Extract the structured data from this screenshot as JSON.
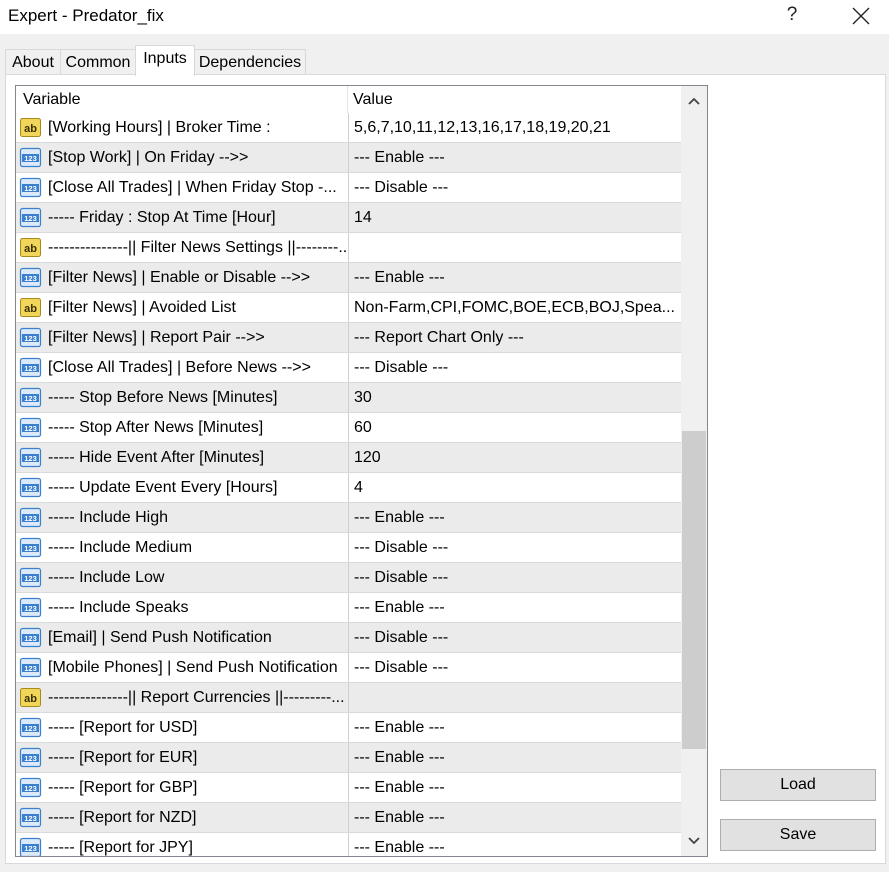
{
  "window": {
    "title": "Expert - Predator_fix",
    "help_label": "?"
  },
  "tabs": [
    {
      "label": "About",
      "active": false
    },
    {
      "label": "Common",
      "active": false
    },
    {
      "label": "Inputs",
      "active": true
    },
    {
      "label": "Dependencies",
      "active": false
    }
  ],
  "grid": {
    "columns": {
      "variable": "Variable",
      "value": "Value"
    },
    "rows": [
      {
        "icon": "ab",
        "variable": "[Working Hours] | Broker Time :",
        "value": "5,6,7,10,11,12,13,16,17,18,19,20,21"
      },
      {
        "icon": "123",
        "variable": "[Stop Work] | On Friday -->>",
        "value": "--- Enable ---"
      },
      {
        "icon": "123",
        "variable": "[Close All Trades] | When Friday Stop -...",
        "value": "--- Disable ---"
      },
      {
        "icon": "123",
        "variable": "----- Friday : Stop At Time [Hour]",
        "value": "14"
      },
      {
        "icon": "ab",
        "variable": "---------------|| Filter News Settings ||--------...",
        "value": ""
      },
      {
        "icon": "123",
        "variable": "[Filter News] | Enable or Disable -->>",
        "value": "--- Enable ---"
      },
      {
        "icon": "ab",
        "variable": "[Filter News] | Avoided List",
        "value": "Non-Farm,CPI,FOMC,BOE,ECB,BOJ,Spea..."
      },
      {
        "icon": "123",
        "variable": "[Filter News] | Report Pair -->>",
        "value": "--- Report Chart Only ---"
      },
      {
        "icon": "123",
        "variable": "[Close All Trades] | Before News -->>",
        "value": "--- Disable ---"
      },
      {
        "icon": "123",
        "variable": "----- Stop Before News [Minutes]",
        "value": "30"
      },
      {
        "icon": "123",
        "variable": "----- Stop After News [Minutes]",
        "value": "60"
      },
      {
        "icon": "123",
        "variable": "----- Hide Event After [Minutes]",
        "value": "120"
      },
      {
        "icon": "123",
        "variable": "----- Update Event Every [Hours]",
        "value": "4"
      },
      {
        "icon": "123",
        "variable": "----- Include High",
        "value": "--- Enable ---"
      },
      {
        "icon": "123",
        "variable": "----- Include Medium",
        "value": "--- Disable ---"
      },
      {
        "icon": "123",
        "variable": "----- Include Low",
        "value": "--- Disable ---"
      },
      {
        "icon": "123",
        "variable": "----- Include Speaks",
        "value": "--- Enable ---"
      },
      {
        "icon": "123",
        "variable": "[Email] | Send Push Notification",
        "value": "--- Disable ---"
      },
      {
        "icon": "123",
        "variable": "[Mobile Phones] | Send Push Notification",
        "value": "--- Disable ---"
      },
      {
        "icon": "ab",
        "variable": "---------------|| Report Currencies ||---------...",
        "value": ""
      },
      {
        "icon": "123",
        "variable": "----- [Report for USD]",
        "value": "--- Enable ---"
      },
      {
        "icon": "123",
        "variable": "----- [Report for EUR]",
        "value": "--- Enable ---"
      },
      {
        "icon": "123",
        "variable": "----- [Report for GBP]",
        "value": "--- Enable ---"
      },
      {
        "icon": "123",
        "variable": "----- [Report for NZD]",
        "value": "--- Enable ---"
      },
      {
        "icon": "123",
        "variable": "----- [Report for JPY]",
        "value": "--- Enable ---"
      }
    ]
  },
  "buttons": {
    "load": "Load",
    "save": "Save"
  },
  "colors": {
    "row_alt": "#ebebeb",
    "row_normal": "#ffffff",
    "icon_ab_fill": "#f2d65a",
    "icon_123_fill": "#3b7fd0"
  }
}
